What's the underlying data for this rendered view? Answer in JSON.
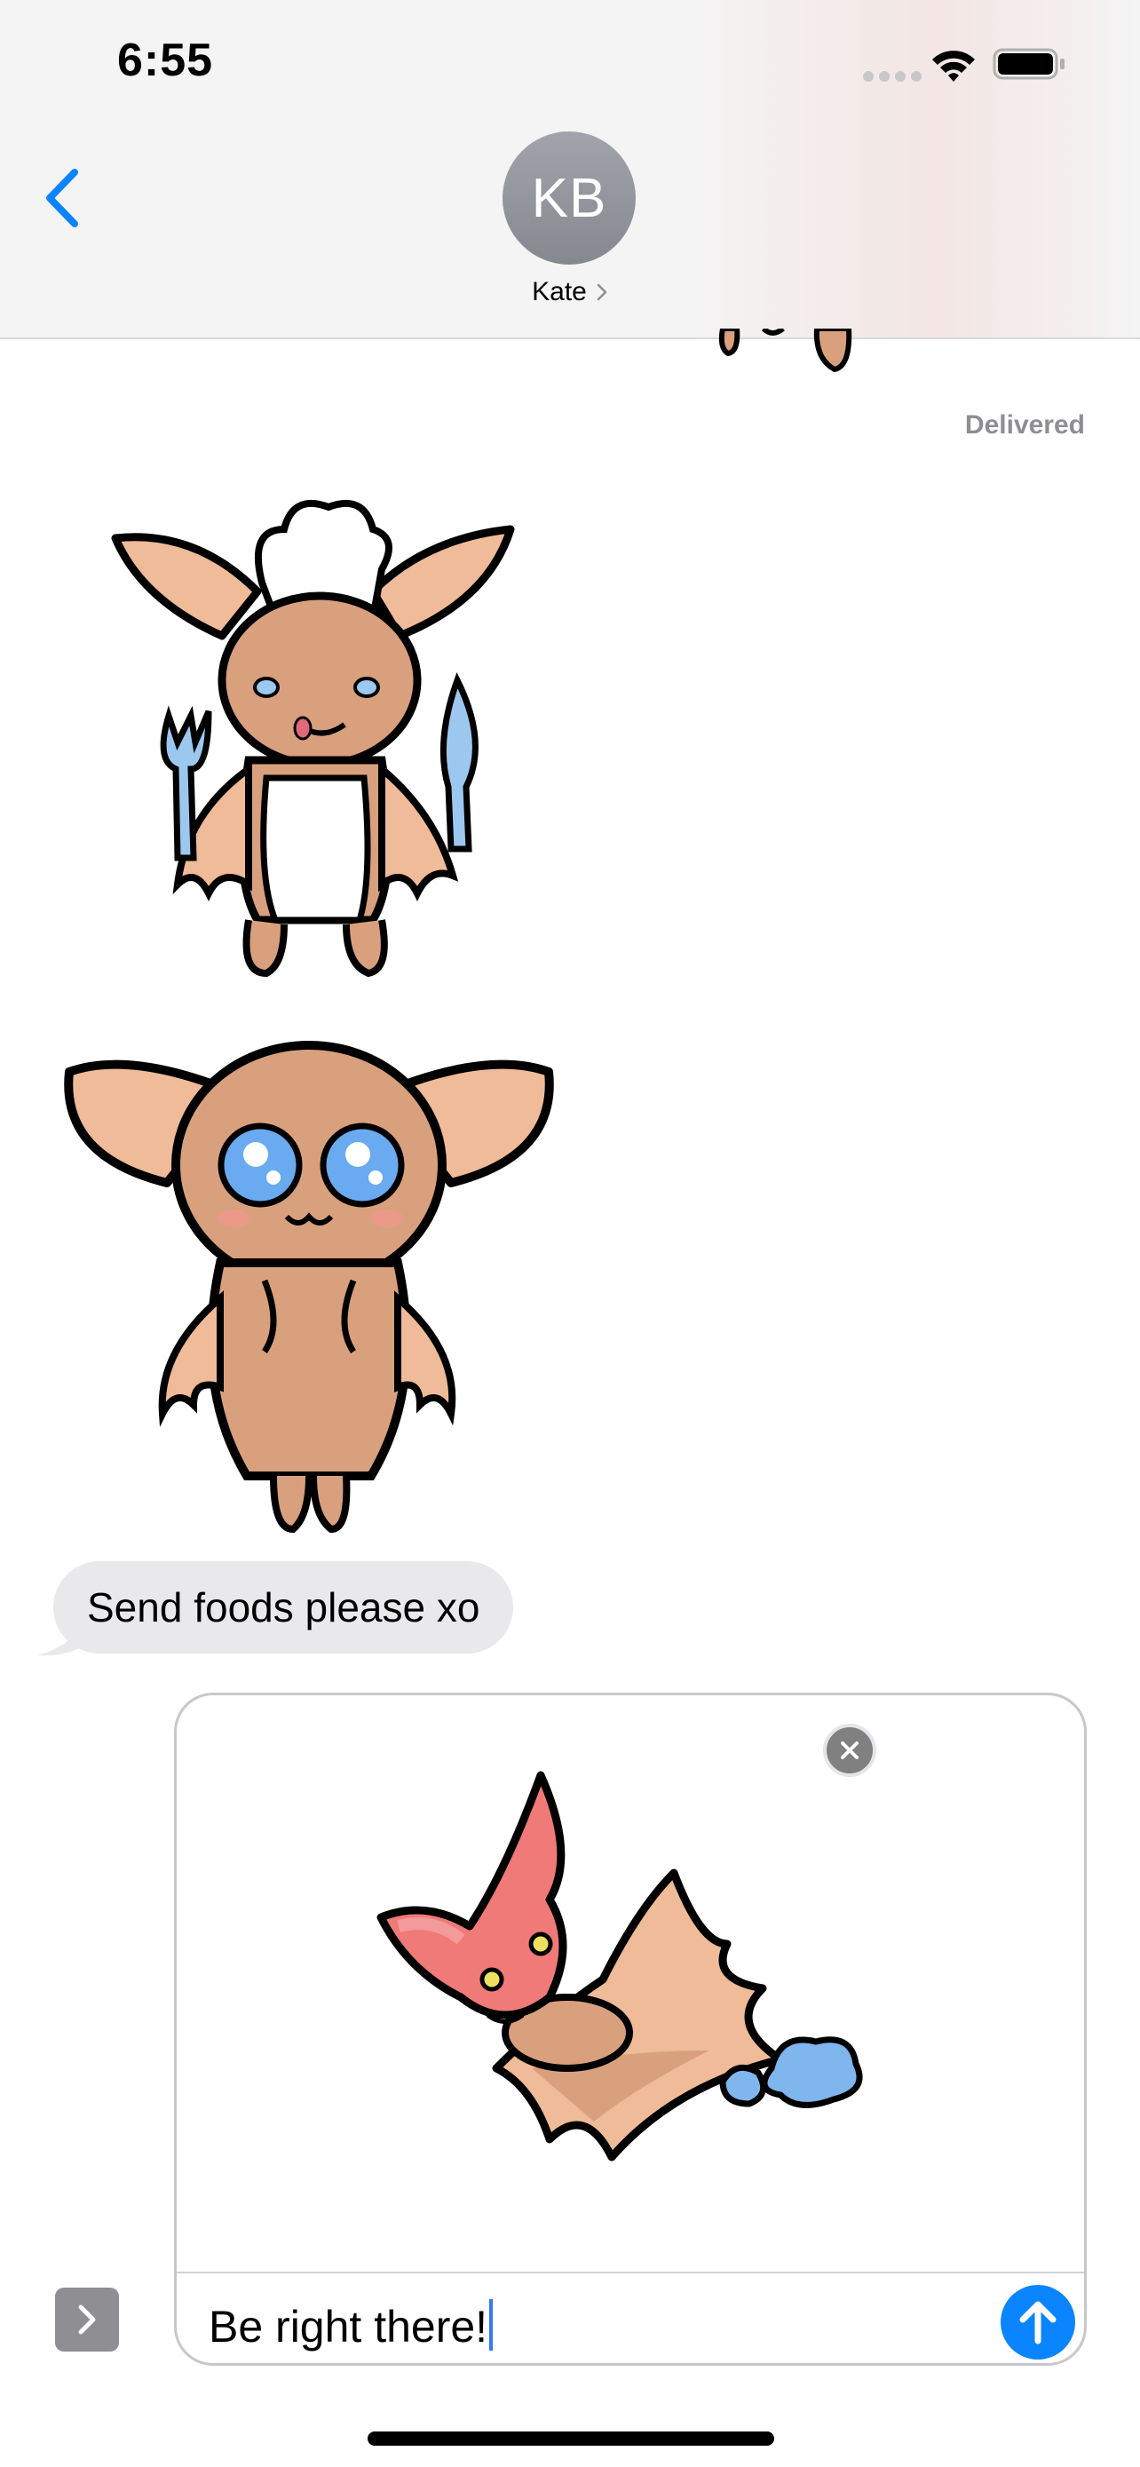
{
  "status_bar": {
    "time": "6:55",
    "signal_icon": "cellular-dots-icon",
    "wifi_icon": "wifi-icon",
    "battery_icon": "battery-icon"
  },
  "header": {
    "back_icon": "chevron-left-icon",
    "avatar_initials": "KB",
    "contact_name": "Kate",
    "contact_chevron_icon": "chevron-right-icon"
  },
  "conversation": {
    "delivered_label": "Delivered",
    "stickers": [
      {
        "name": "chef-bat-sticker"
      },
      {
        "name": "cute-bat-sticker"
      }
    ],
    "incoming_message": "Send foods please xo"
  },
  "composer": {
    "attachment": "flying-bat-sticker",
    "remove_icon": "close-icon",
    "input_value": "Be right there!",
    "send_icon": "arrow-up-icon",
    "apps_icon": "chevron-right-icon"
  },
  "colors": {
    "accent": "#0a84ff",
    "bubble_incoming": "#e9e9eb",
    "delivered_text": "#8e8e93",
    "bat_skin": "#d9a07e",
    "bat_pink": "#f07a78",
    "spoon_blue": "#9cc8f0"
  }
}
